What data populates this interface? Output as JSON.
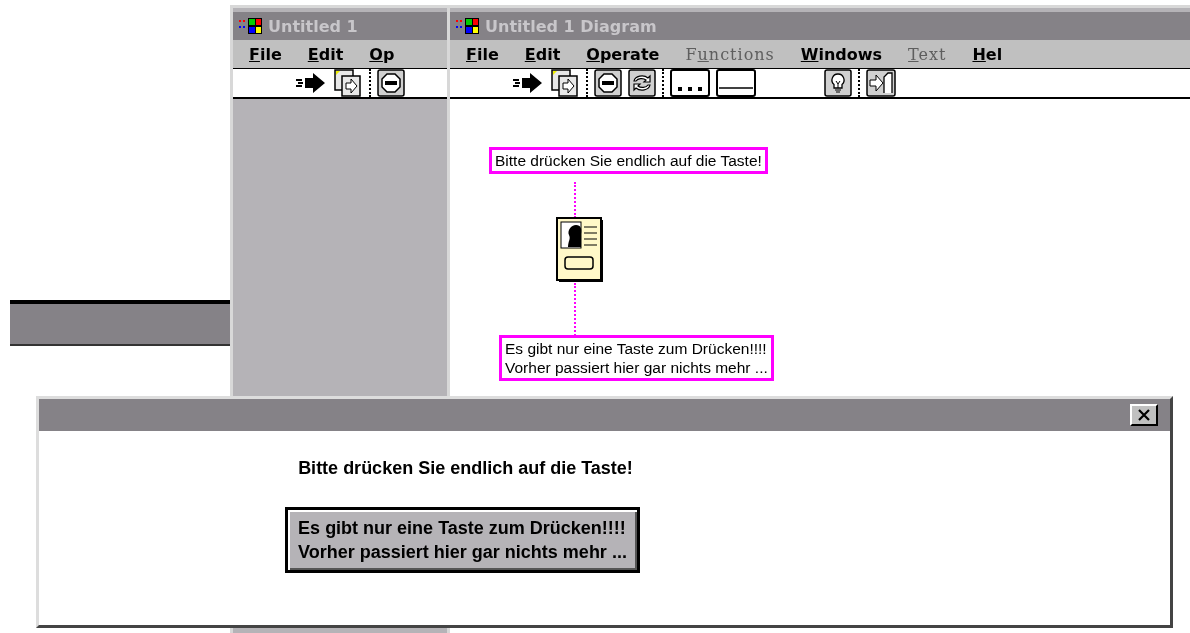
{
  "panel_window": {
    "title": "Untitled 1",
    "menu": [
      {
        "key": "F",
        "after": "ile",
        "disabled": false
      },
      {
        "key": "E",
        "after": "dit",
        "disabled": false
      },
      {
        "key": "O",
        "after": "p",
        "disabled": false
      }
    ],
    "toolbar": [
      {
        "kind": "run"
      },
      {
        "kind": "run-continuous"
      },
      {
        "kind": "separator"
      },
      {
        "kind": "stop"
      }
    ]
  },
  "diagram_window": {
    "title": "Untitled 1 Diagram",
    "menu": [
      {
        "key": "F",
        "after": "ile",
        "disabled": false
      },
      {
        "key": "E",
        "after": "dit",
        "disabled": false
      },
      {
        "key": "O",
        "after": "perate",
        "disabled": false
      },
      {
        "before": "F",
        "key": "u",
        "after": "nctions",
        "disabled": true
      },
      {
        "key": "W",
        "after": "indows",
        "disabled": false
      },
      {
        "key": "T",
        "after": "ext",
        "disabled": true
      },
      {
        "key": "H",
        "after": "el",
        "disabled": false
      }
    ],
    "toolbar": [
      {
        "kind": "run"
      },
      {
        "kind": "run-continuous"
      },
      {
        "kind": "separator"
      },
      {
        "kind": "stop"
      },
      {
        "kind": "pause"
      },
      {
        "kind": "separator"
      },
      {
        "kind": "dots"
      },
      {
        "kind": "line"
      },
      {
        "kind": "spacer"
      },
      {
        "kind": "bulb"
      },
      {
        "kind": "separator"
      },
      {
        "kind": "step"
      }
    ],
    "labels": [
      "Bitte drücken Sie endlich auf die Taste!",
      "Es gibt nur eine Taste zum Drücken!!!!\nVorher passiert hier gar nichts mehr ..."
    ]
  },
  "dialog": {
    "message": "Bitte drücken Sie endlich auf die Taste!",
    "button": "Es gibt nur eine Taste zum Drücken!!!!\nVorher passiert hier gar nichts mehr ..."
  }
}
